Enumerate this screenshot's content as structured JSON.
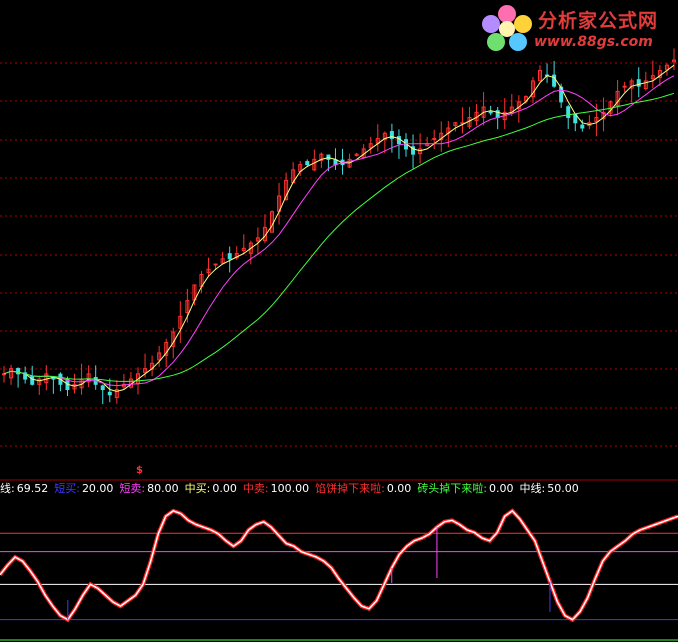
{
  "watermark": {
    "title": "分析家公式网",
    "url": "www.88gs.com"
  },
  "signal_marker": "$",
  "legend": [
    {
      "label": "线:",
      "value": "69.52",
      "color": "#ffffff"
    },
    {
      "label": "短买:",
      "value": "20.00",
      "color": "#3a3aff"
    },
    {
      "label": "短卖:",
      "value": "80.00",
      "color": "#ff40ff"
    },
    {
      "label": "中买:",
      "value": "0.00",
      "color": "#ffff80"
    },
    {
      "label": "中卖:",
      "value": "100.00",
      "color": "#ff3030"
    },
    {
      "label": "馅饼掉下来啦:",
      "value": "0.00",
      "color": "#ff3030"
    },
    {
      "label": "砖头掉下来啦:",
      "value": "0.00",
      "color": "#40ff40"
    },
    {
      "label": "中线:",
      "value": "50.00",
      "color": "#ffffff"
    }
  ],
  "colors": {
    "candle_up": "#ff3030",
    "candle_down": "#40e0e0",
    "ma_short": "#ffff80",
    "ma_mid": "#ff40ff",
    "ma_long": "#40ff40",
    "grid": "#b00000",
    "osc_line": "#ffffff",
    "osc_marker": "#ff2020"
  },
  "chart_data": [
    {
      "type": "candlestick",
      "title": "",
      "price_path": [
        30,
        31,
        30,
        29,
        28,
        29,
        30,
        29,
        28,
        27,
        28,
        29,
        30,
        28,
        27,
        26,
        27,
        28,
        29,
        30,
        31,
        32,
        34,
        36,
        38,
        41,
        44,
        47,
        49,
        50,
        51,
        52,
        52,
        53,
        54,
        55,
        56,
        58,
        61,
        64,
        67,
        69,
        70,
        70,
        71,
        72,
        71,
        70,
        70,
        71,
        72,
        73,
        74,
        75,
        76,
        75,
        74,
        73,
        72,
        73,
        74,
        75,
        76,
        77,
        78,
        78,
        79,
        80,
        81,
        80,
        79,
        80,
        81,
        82,
        83,
        86,
        88,
        87,
        85,
        82,
        79,
        78,
        77,
        78,
        79,
        80,
        82,
        84,
        85,
        86,
        85,
        86,
        87,
        88,
        89,
        90
      ],
      "ma_lines": [
        "MA short",
        "MA mid",
        "MA long"
      ],
      "ylim": [
        0,
        100
      ]
    },
    {
      "type": "line",
      "title": "",
      "ylim": [
        0,
        100
      ],
      "reference_levels": {
        "short_buy": 20,
        "short_sell": 80,
        "mid_buy": 0,
        "mid_sell": 100,
        "mid_line": 50
      },
      "osc_values": [
        45,
        52,
        58,
        55,
        48,
        40,
        30,
        22,
        15,
        12,
        20,
        30,
        38,
        35,
        30,
        25,
        22,
        26,
        30,
        38,
        55,
        75,
        88,
        92,
        90,
        85,
        82,
        80,
        78,
        75,
        70,
        66,
        70,
        78,
        82,
        84,
        80,
        74,
        68,
        66,
        62,
        60,
        58,
        55,
        50,
        42,
        35,
        28,
        22,
        20,
        26,
        38,
        50,
        60,
        66,
        70,
        72,
        75,
        80,
        84,
        85,
        82,
        78,
        76,
        72,
        70,
        76,
        88,
        92,
        86,
        78,
        70,
        55,
        40,
        25,
        15,
        12,
        18,
        28,
        42,
        55,
        62,
        66,
        70,
        75,
        78,
        80,
        82,
        84,
        86,
        88
      ]
    }
  ]
}
